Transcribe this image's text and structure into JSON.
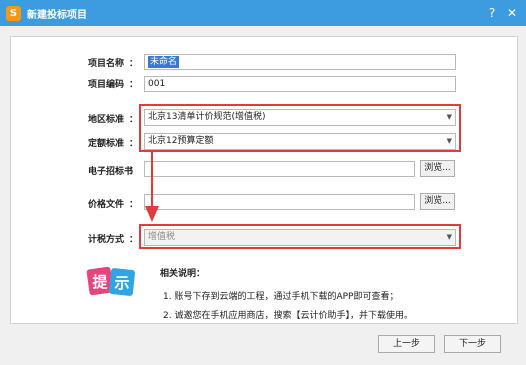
{
  "window": {
    "title": "新建投标项目",
    "help_glyph": "?",
    "close_glyph": "✕"
  },
  "form": {
    "project_name": {
      "label": "项目名称",
      "value": "未命名"
    },
    "project_code": {
      "label": "项目编码",
      "value": "001"
    },
    "region_standard": {
      "label": "地区标准",
      "value": "北京13清单计价规范(增值税)"
    },
    "quota_standard": {
      "label": "定额标准",
      "value": "北京12预算定额"
    },
    "tender_doc": {
      "label": "电子招标书",
      "value": "",
      "browse_label": "浏览..."
    },
    "price_file": {
      "label": "价格文件",
      "value": "",
      "browse_label": "浏览..."
    },
    "tax_method": {
      "label": "计税方式",
      "value": "增值税"
    },
    "colon": "："
  },
  "help": {
    "logo_text_1": "提",
    "logo_text_2": "示",
    "title": "相关说明：",
    "lines": [
      "1. 账号下存到云端的工程，通过手机下载的APP即可查看；",
      "2. 诚邀您在手机应用商店，搜索【云计价助手】，并下载使用。"
    ]
  },
  "buttons": {
    "prev": "上一步",
    "next": "下一步"
  },
  "colors": {
    "titlebar": "#3d9be0",
    "highlight_box": "#e03c3c",
    "selection": "#3978d7"
  }
}
